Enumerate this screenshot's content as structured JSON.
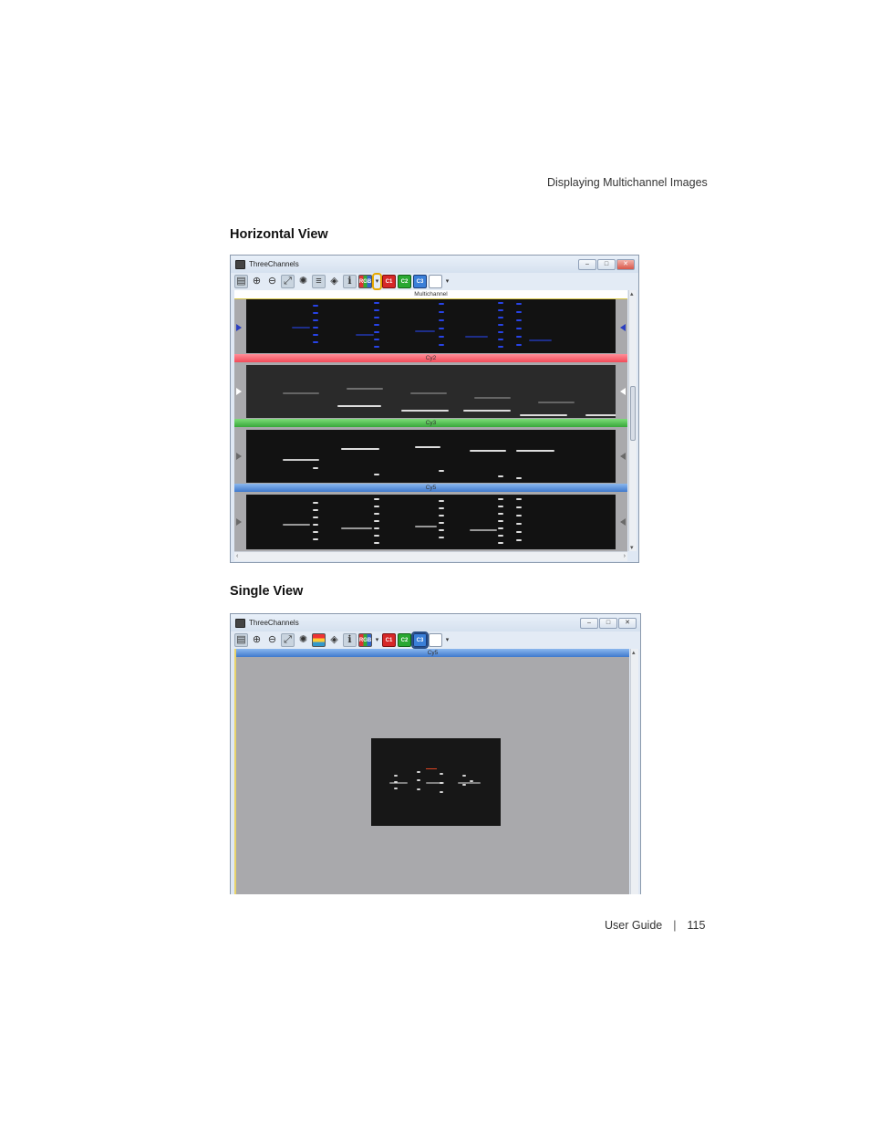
{
  "page": {
    "running_header": "Displaying Multichannel Images",
    "footer_label": "User Guide",
    "footer_separator": "|",
    "page_number": "115"
  },
  "sections": [
    {
      "heading": "Horizontal View"
    },
    {
      "heading": "Single View"
    }
  ],
  "windows": [
    {
      "title": "ThreeChannels",
      "controls": [
        "–",
        "□",
        "✕"
      ],
      "toolbar": [
        "RGB",
        "C1",
        "C2",
        "C3"
      ],
      "panes": [
        {
          "label": "Multichannel",
          "color": "#ffffff"
        },
        {
          "label": "Cy2",
          "color": "#f24a58"
        },
        {
          "label": "Cy3",
          "color": "#37a83a"
        },
        {
          "label": "Cy5",
          "color": "#3f79cc"
        }
      ]
    },
    {
      "title": "ThreeChannels",
      "controls": [
        "–",
        "□",
        "✕"
      ],
      "toolbar": [
        "RGB",
        "C1",
        "C2",
        "C3"
      ],
      "panes": [
        {
          "label": "Cy5",
          "color": "#3f79cc"
        }
      ]
    }
  ],
  "icons": [
    "file-open-icon",
    "zoom-in-icon",
    "zoom-out-icon",
    "fit-window-icon",
    "contrast-icon",
    "layout-icon",
    "rotate-icon",
    "info-icon",
    "channel-icon",
    "view-mode-icon"
  ]
}
